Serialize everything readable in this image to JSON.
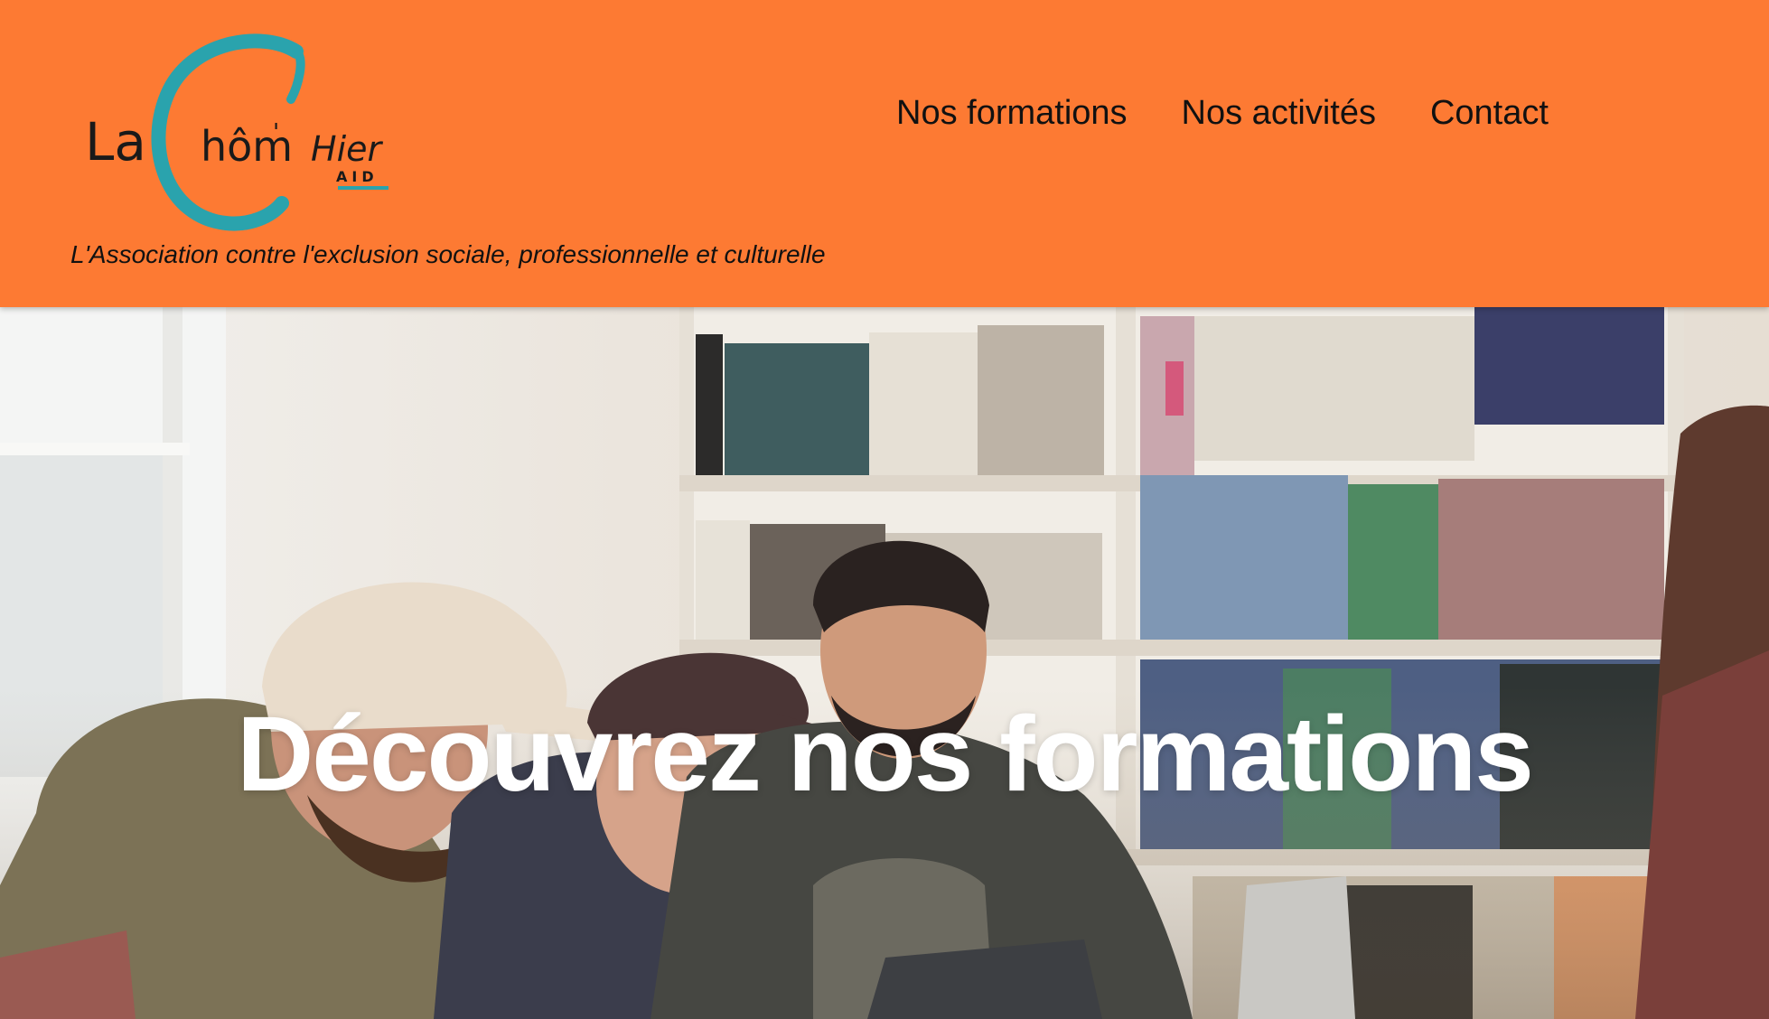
{
  "header": {
    "background_color": "#fd7a33",
    "logo": {
      "text_la": "La",
      "text_chom": "hôm",
      "text_hier": "Hier",
      "text_aid": "AID",
      "accent_color": "#2aa3ad"
    },
    "tagline": "L'Association contre l'exclusion sociale, professionnelle et culturelle"
  },
  "nav": {
    "items": [
      {
        "label": "Nos formations"
      },
      {
        "label": "Nos activités"
      },
      {
        "label": "Contact"
      }
    ]
  },
  "hero": {
    "title": "Découvrez nos formations",
    "image_description_icon": "hero-photo"
  }
}
